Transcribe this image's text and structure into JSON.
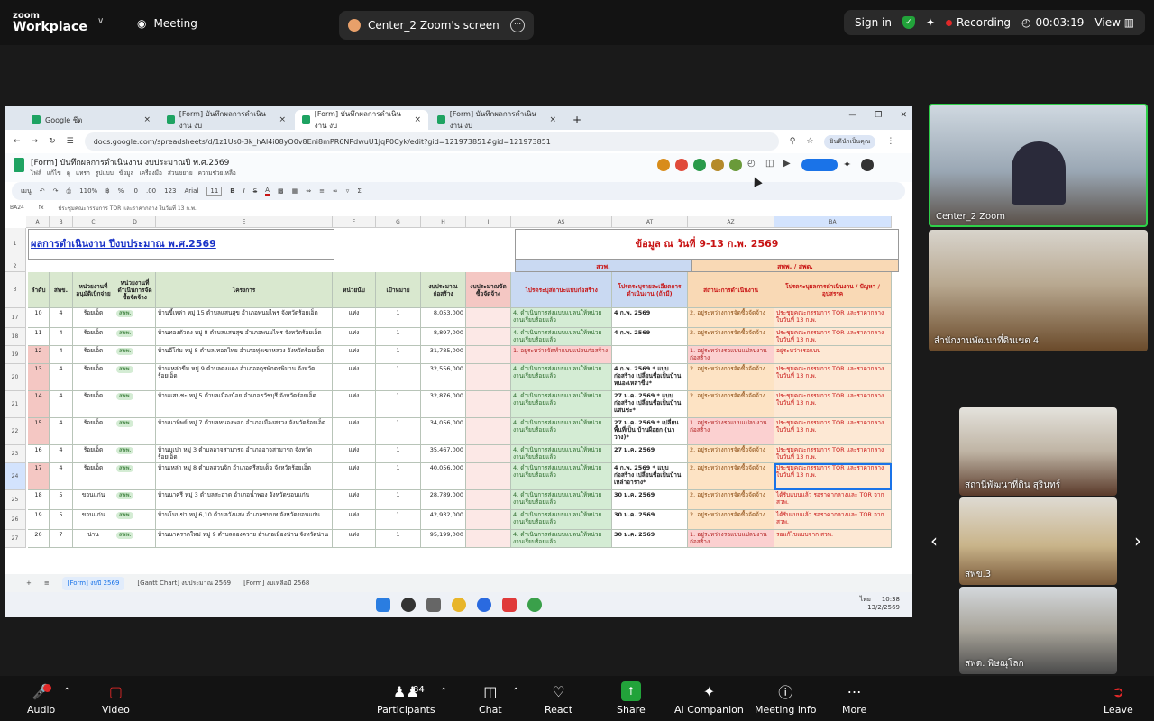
{
  "zoom": {
    "brand_small": "zoom",
    "brand_large": "Workplace",
    "meeting_label": "Meeting",
    "share_tab": "Center_2 Zoom's screen",
    "sign_in": "Sign in",
    "recording": "Recording",
    "timer": "00:03:19",
    "view": "View"
  },
  "browser": {
    "tabs": [
      "Google ชีต",
      "[Form] บันทึกผลการดำเนินงาน งบ",
      "[Form] บันทึกผลการดำเนินงาน งบ",
      "[Form] บันทึกผลการดำเนินงาน งบ"
    ],
    "url": "docs.google.com/spreadsheets/d/1z1Us0-3k_hAl4i08yO0v8Eni8mPR6NPdwuU1JqP0Cyk/edit?gid=121973851#gid=121973851",
    "profile": "ยินดีนำเป็นคุณ"
  },
  "sheet": {
    "doc_title": "[Form] บันทึกผลการดำเนินงาน งบประมาณปี พ.ศ.2569",
    "menus": [
      "ไฟล์",
      "แก้ไข",
      "ดู",
      "แทรก",
      "รูปแบบ",
      "ข้อมูล",
      "เครื่องมือ",
      "ส่วนขยาย",
      "ความช่วยเหลือ"
    ],
    "toolbar": [
      "เมนู",
      "110%",
      "฿",
      "%",
      ".0",
      ".00",
      "123",
      "Arial",
      "11",
      "B",
      "I",
      "S",
      "A"
    ],
    "name_box": "BA24",
    "formula": "ประชุมคณะกรรมการ TOR และราคากลาง ในวันที่ 13 ก.พ.",
    "col_letters": [
      "A",
      "B",
      "C",
      "D",
      "E",
      "F",
      "G",
      "H",
      "I",
      "AS",
      "AT",
      "AZ",
      "BA"
    ],
    "title_left": "ผลการดำเนินงาน ปีงบประมาณ พ.ศ.2569",
    "title_right": "ข้อมูล ณ วันที่ 9-13 ก.พ. 2569",
    "group_left": "สวพ.",
    "group_right": "สพพ. / สพด.",
    "headers": [
      "ลำดับ",
      "สพข.",
      "หน่วยงานที่อนุมัติเบิกจ่าย",
      "หน่วยงานที่ดำเนินการจัดซื้อจัดจ้าง",
      "โครงการ",
      "หน่วยนับ",
      "เป้าหมาย",
      "งบประมาณก่อสร้าง",
      "งบประมาณจัดซื้อจัดจ้าง",
      "โปรดระบุสถานะแบบก่อสร้าง",
      "โปรดระบุรายละเอียดการดำเนินงาน (ถ้ามี)",
      "สถานะการดำเนินงาน",
      "โปรดระบุผลการดำเนินงาน / ปัญหา / อุปสรรค"
    ],
    "row_numbers": [
      "1",
      "2",
      "3",
      "17",
      "18",
      "19",
      "20",
      "21",
      "22",
      "23",
      "24",
      "25",
      "26",
      "27"
    ],
    "rows": [
      {
        "n": "10",
        "z": "4",
        "u": "ร้อยเอ็ด",
        "p": "สพพ.",
        "proj": "บ้านขี้เหล่า หมู่ 15 ตำบลแสนสุข อำเภอพนมไพร จังหวัดร้อยเอ็ด",
        "unit": "แห่ง",
        "t": "1",
        "b": "8,053,000",
        "as": "4. ดำเนินการส่งแบบแปลนให้หน่วยงานเรียบร้อยแล้ว",
        "at": "4 ก.พ. 2569",
        "az": "2. อยู่ระหว่างการจัดซื้อจัดจ้าง",
        "ba": "ประชุมคณะกรรมการ TOR และราคากลาง ในวันที่ 13 ก.พ.",
        "c": "o"
      },
      {
        "n": "11",
        "z": "4",
        "u": "ร้อยเอ็ด",
        "p": "สพพ.",
        "proj": "บ้านทองตัวดง หมู่ 8 ตำบลแสนสุข อำเภอพนมไพร จังหวัดร้อยเอ็ด",
        "unit": "แห่ง",
        "t": "1",
        "b": "8,897,000",
        "as": "4. ดำเนินการส่งแบบแปลนให้หน่วยงานเรียบร้อยแล้ว",
        "at": "4 ก.พ. 2569",
        "az": "2. อยู่ระหว่างการจัดซื้อจัดจ้าง",
        "ba": "ประชุมคณะกรรมการ TOR และราคากลาง ในวันที่ 13 ก.พ.",
        "c": "o"
      },
      {
        "n": "12",
        "z": "4",
        "u": "ร้อยเอ็ด",
        "p": "สพพ.",
        "proj": "บ้านอีโก่ม หมู่ 8 ตำบลเทอดไทย อำเภอทุ่งเขาหลวง จังหวัดร้อยเอ็ด",
        "unit": "แห่ง",
        "t": "1",
        "b": "31,785,000",
        "as": "1. อยู่ระหว่างจัดทำแบบแปลนก่อสร้าง",
        "at": "",
        "az": "1. อยู่ระหว่างรอแบบแปลนงานก่อสร้าง",
        "ba": "อยู่ระหว่างรอแบบ",
        "c": "r"
      },
      {
        "n": "13",
        "z": "4",
        "u": "ร้อยเอ็ด",
        "p": "สพพ.",
        "proj": "บ้านเหล่าขีม หมู่ 9 ตำบลดงแดง อำเภอจตุรพักตรพิมาน จังหวัดร้อยเอ็ด",
        "unit": "แห่ง",
        "t": "1",
        "b": "32,556,000",
        "as": "4. ดำเนินการส่งแบบแปลนให้หน่วยงานเรียบร้อยแล้ว",
        "at": "4 ก.พ. 2569 * แบบก่อสร้าง เปลี่ยนชื่อเป็นบ้านหนองเหล่าขีม*",
        "az": "2. อยู่ระหว่างการจัดซื้อจัดจ้าง",
        "ba": "ประชุมคณะกรรมการ TOR และราคากลาง ในวันที่ 13 ก.พ.",
        "c": "o"
      },
      {
        "n": "14",
        "z": "4",
        "u": "ร้อยเอ็ด",
        "p": "สพพ.",
        "proj": "บ้านแสนชะ หมู่ 5 ตำบลเมืองน้อย อำเภอธวัชบุรี จังหวัดร้อยเอ็ด",
        "unit": "แห่ง",
        "t": "1",
        "b": "32,876,000",
        "as": "4. ดำเนินการส่งแบบแปลนให้หน่วยงานเรียบร้อยแล้ว",
        "at": "27 ม.ค. 2569 * แบบก่อสร้าง เปลี่ยนชื่อเป็นบ้านแสนชะ*",
        "az": "2. อยู่ระหว่างการจัดซื้อจัดจ้าง",
        "ba": "ประชุมคณะกรรมการ TOR และราคากลาง ในวันที่ 13 ก.พ.",
        "c": "o"
      },
      {
        "n": "15",
        "z": "4",
        "u": "ร้อยเอ็ด",
        "p": "สพพ.",
        "proj": "บ้านนาทิพย์ หมู่ 7 ตำบลหนองพอก อำเภอเมืองสรวง จังหวัดร้อยเอ็ด",
        "unit": "แห่ง",
        "t": "1",
        "b": "34,056,000",
        "as": "4. ดำเนินการส่งแบบแปลนให้หน่วยงานเรียบร้อยแล้ว",
        "at": "27 ม.ค. 2569 * เปลี่ยนพื้นที่เป็น บ้านผือฮก (นาวาง)*",
        "az": "1. อยู่ระหว่างรอแบบแปลนงานก่อสร้าง",
        "ba": "ประชุมคณะกรรมการ TOR และราคากลาง ในวันที่ 13 ก.พ.",
        "c": "r"
      },
      {
        "n": "16",
        "z": "4",
        "u": "ร้อยเอ็ด",
        "p": "สพพ.",
        "proj": "บ้านบุเปา หมู่ 3 ตำบลอาจสามารถ อำเภออาจสามารถ จังหวัดร้อยเอ็ด",
        "unit": "แห่ง",
        "t": "1",
        "b": "35,467,000",
        "as": "4. ดำเนินการส่งแบบแปลนให้หน่วยงานเรียบร้อยแล้ว",
        "at": "27 ม.ค. 2569",
        "az": "2. อยู่ระหว่างการจัดซื้อจัดจ้าง",
        "ba": "ประชุมคณะกรรมการ TOR และราคากลาง ในวันที่ 13 ก.พ.",
        "c": "o"
      },
      {
        "n": "17",
        "z": "4",
        "u": "ร้อยเอ็ด",
        "p": "สพพ.",
        "proj": "บ้านเหล่า หมู่ 8 ตำบลสวนจิก อำเภอศรีสมเด็จ จังหวัดร้อยเอ็ด",
        "unit": "แห่ง",
        "t": "1",
        "b": "40,056,000",
        "as": "4. ดำเนินการส่งแบบแปลนให้หน่วยงานเรียบร้อยแล้ว",
        "at": "4 ก.พ. 2569 * แบบก่อสร้าง เปลี่ยนชื่อเป็นบ้านเหล่าอาราง*",
        "az": "2. อยู่ระหว่างการจัดซื้อจัดจ้าง",
        "ba": "ประชุมคณะกรรมการ TOR และราคากลาง ในวันที่ 13 ก.พ.",
        "c": "o"
      },
      {
        "n": "18",
        "z": "5",
        "u": "ขอนแก่น",
        "p": "สพพ.",
        "proj": "บ้านนาศรี หมู่ 3 ตำบลสะอาด อำเภอน้ำพอง จังหวัดขอนแก่น",
        "unit": "แห่ง",
        "t": "1",
        "b": "28,789,000",
        "as": "4. ดำเนินการส่งแบบแปลนให้หน่วยงานเรียบร้อยแล้ว",
        "at": "30 ม.ค. 2569",
        "az": "2. อยู่ระหว่างการจัดซื้อจัดจ้าง",
        "ba": "ได้รับแบบแล้ว รอราคากลางและ TOR จาก สวพ.",
        "c": "o"
      },
      {
        "n": "19",
        "z": "5",
        "u": "ขอนแก่น",
        "p": "สพพ.",
        "proj": "บ้านโนนข่า หมู่ 6,10 ตำบลวังแสง อำเภอชนบท จังหวัดขอนแก่น",
        "unit": "แห่ง",
        "t": "1",
        "b": "42,932,000",
        "as": "4. ดำเนินการส่งแบบแปลนให้หน่วยงานเรียบร้อยแล้ว",
        "at": "30 ม.ค. 2569",
        "az": "2. อยู่ระหว่างการจัดซื้อจัดจ้าง",
        "ba": "ได้รับแบบแล้ว รอราคากลางและ TOR จาก สวพ.",
        "c": "o"
      },
      {
        "n": "20",
        "z": "7",
        "u": "น่าน",
        "p": "สพพ.",
        "proj": "บ้านนาคราดใหม่ หมู่ 9 ตำบลกองควาย อำเภอเมืองน่าน จังหวัดน่าน",
        "unit": "แห่ง",
        "t": "1",
        "b": "95,199,000",
        "as": "4. ดำเนินการส่งแบบแปลนให้หน่วยงานเรียบร้อยแล้ว",
        "at": "30 ม.ค. 2569",
        "az": "1. อยู่ระหว่างรอแบบแปลนงานก่อสร้าง",
        "ba": "รอแก้ไขแบบจาก สวพ.",
        "c": "r"
      }
    ],
    "sheet_tabs": [
      "[Form] งบปี 2569",
      "[Gantt Chart] งบประมาณ 2569",
      "[Form] งบเหลือปี 2568"
    ],
    "tray_time": "10:38",
    "tray_date": "13/2/2569",
    "tray_lang": "ไทย"
  },
  "participants": {
    "tiles": [
      "Center_2 Zoom",
      "สำนักงานพัฒนาที่ดินเขต 4",
      "สถานีพัฒนาที่ดิน สุรินทร์",
      "สพข.3",
      "สพด. พิษณุโลก"
    ]
  },
  "controls": {
    "audio": "Audio",
    "video": "Video",
    "participants": "Participants",
    "participants_count": "84",
    "chat": "Chat",
    "react": "React",
    "share": "Share",
    "ai": "AI Companion",
    "info": "Meeting info",
    "more": "More",
    "leave": "Leave"
  }
}
